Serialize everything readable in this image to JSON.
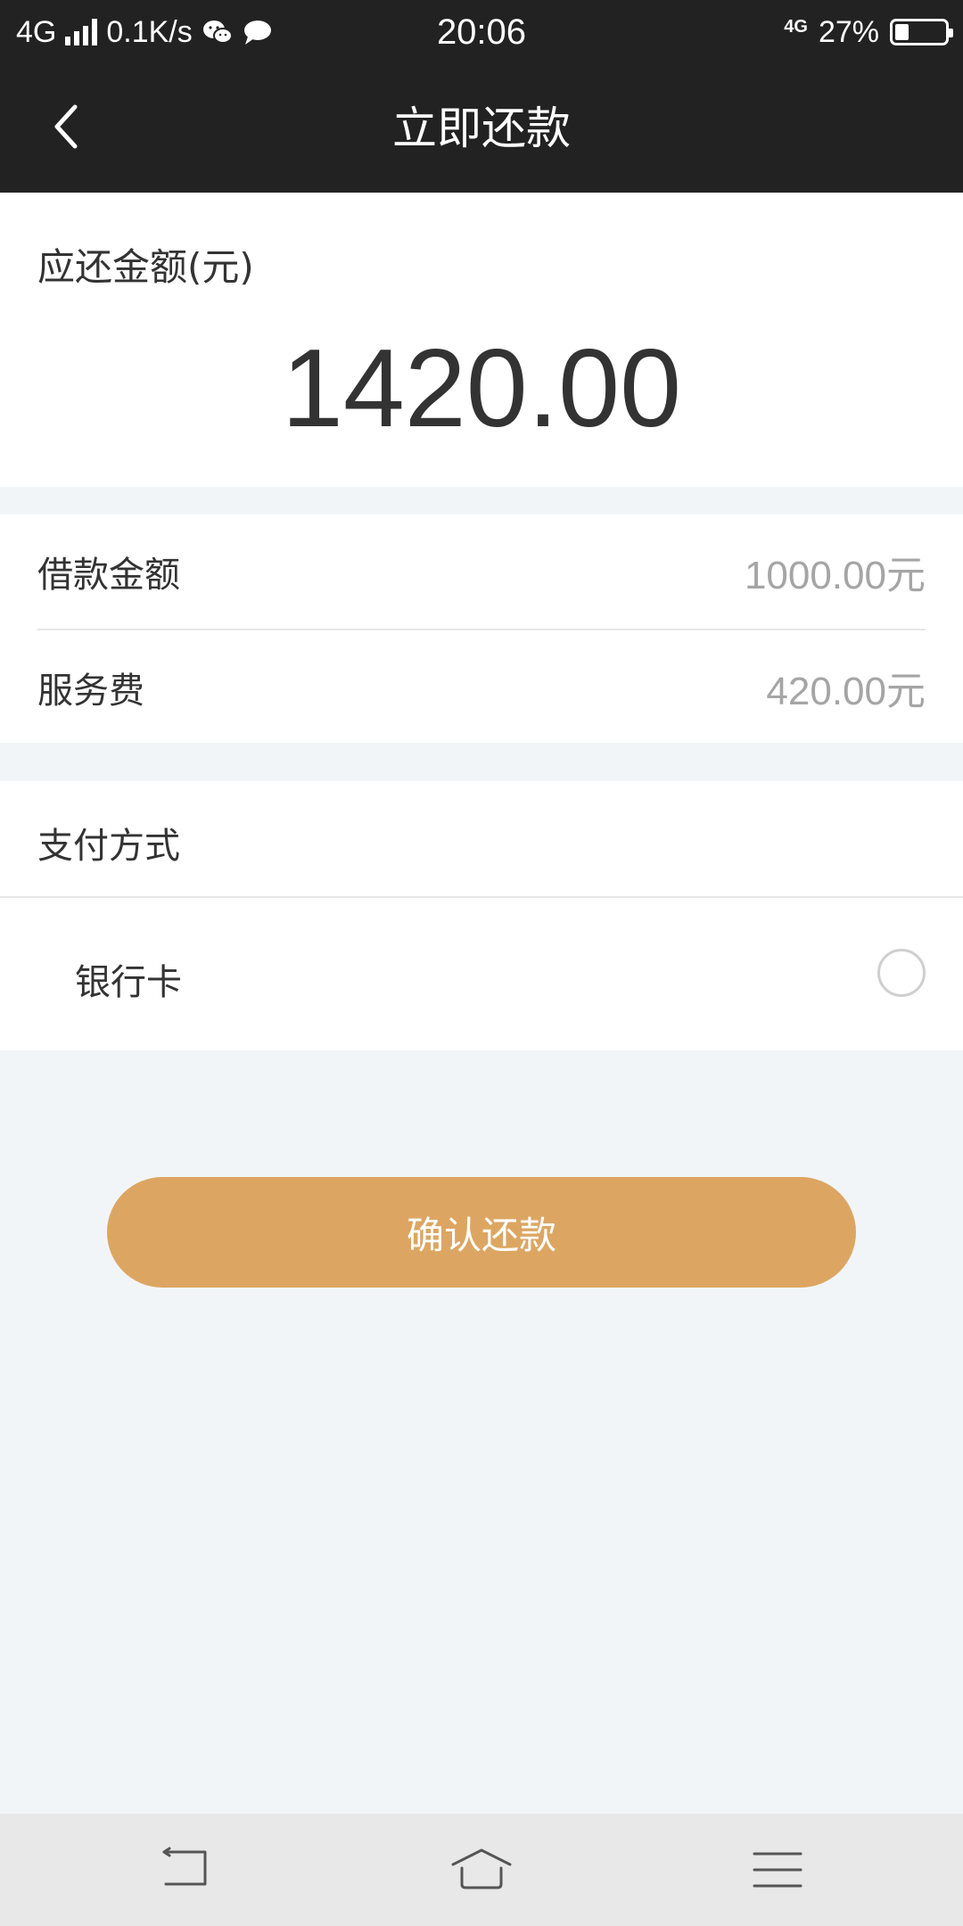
{
  "status_bar": {
    "network": "4G",
    "speed": "0.1K/s",
    "time": "20:06",
    "network_small": "4G",
    "battery_percent": "27%",
    "battery_level": 0.27,
    "icons": [
      "signal-icon",
      "wechat-icon",
      "message-icon",
      "battery-icon"
    ]
  },
  "nav": {
    "title": "立即还款",
    "back_icon": "chevron-left-icon"
  },
  "amount": {
    "label": "应还金额(元)",
    "value": "1420.00"
  },
  "details": [
    {
      "label": "借款金额",
      "value": "1000.00元"
    },
    {
      "label": "服务费",
      "value": "420.00元"
    }
  ],
  "payment": {
    "title": "支付方式",
    "options": [
      {
        "label": "银行卡",
        "selected": false
      }
    ]
  },
  "confirm_label": "确认还款",
  "colors": {
    "header_bg": "#222222",
    "accent": "#dca662",
    "page_bg": "#f2f5f8",
    "muted_text": "#a5a5a5"
  },
  "system_nav": [
    "back-icon",
    "home-icon",
    "menu-icon"
  ]
}
